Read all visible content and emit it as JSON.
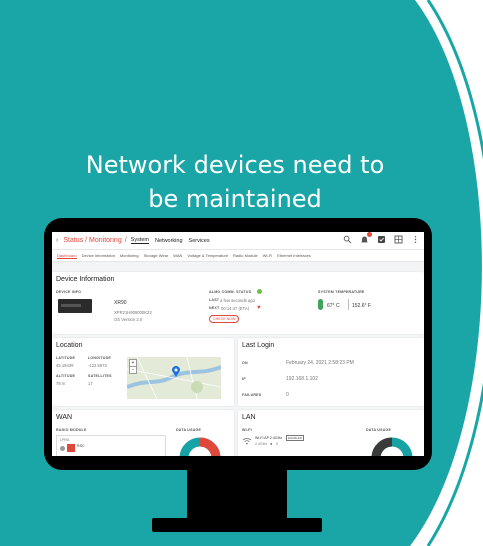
{
  "headline": {
    "line1": "Network devices need to",
    "line2": "be maintained"
  },
  "colors": {
    "teal": "#1aa6a7",
    "accent": "#e0483b",
    "monitor": "#000000"
  },
  "app": {
    "breadcrumb_title": "Status / Monitoring",
    "breadcrumb_sep": "/",
    "nav": [
      "System",
      "Networking",
      "Services"
    ],
    "subtabs": [
      "Dashboard",
      "Device Information",
      "Monitoring",
      "Storage Wear",
      "WAN",
      "Voltage & Temperature",
      "Radio Module",
      "Wi-Fi",
      "Ethernet Interfaces"
    ],
    "icons": [
      "search-icon",
      "bell-icon",
      "checkbox-icon",
      "grid-icon",
      "more-icon"
    ]
  },
  "device": {
    "title": "Device Information",
    "info_label": "DEVICE INFO",
    "model": "XR90",
    "serial": "XPR21H909000K23",
    "os": "OS Version 2.0",
    "almo_label": "ALMO COMM. STATUS",
    "last_label": "LAST",
    "last_value": "a few seconds ago",
    "next_label": "NEXT",
    "next_value": "00:14:47 (ETA)",
    "check_now": "CHECK NOW",
    "temp_label": "SYSTEM TEMPERATURE",
    "temp_c": "67° C",
    "temp_f": "152.6° F"
  },
  "location": {
    "title": "Location",
    "lat_label": "LATITUDE",
    "lat_value": "45.19439",
    "lon_label": "LONGITUDE",
    "lon_value": "-122.5973",
    "alt_label": "ALTITUDE",
    "alt_value": "78 m",
    "sat_label": "SATELLITES",
    "sat_value": "17",
    "zoom_in": "+",
    "zoom_out": "−"
  },
  "last_login": {
    "title": "Last Login",
    "on_label": "ON",
    "on_value": "February 24, 2021 2:58:23 PM",
    "ip_label": "IP",
    "ip_value": "192.168.1.102",
    "fail_label": "FAILURES",
    "fail_value": "0"
  },
  "wan": {
    "title": "WAN",
    "radio_label": "RADIO MODULE",
    "usage_label": "DATA USAGE",
    "radio_name": "LPRA",
    "radio_sub": "RSC"
  },
  "lan": {
    "title": "LAN",
    "wifi_label": "WI-FI",
    "usage_label": "DATA USAGE",
    "wifi_name": "Wi-Fi AP 2.4GHz",
    "wifi_badge": "ENABLED",
    "wifi_detail": "2.4GHz",
    "wifi_clients": "0"
  }
}
